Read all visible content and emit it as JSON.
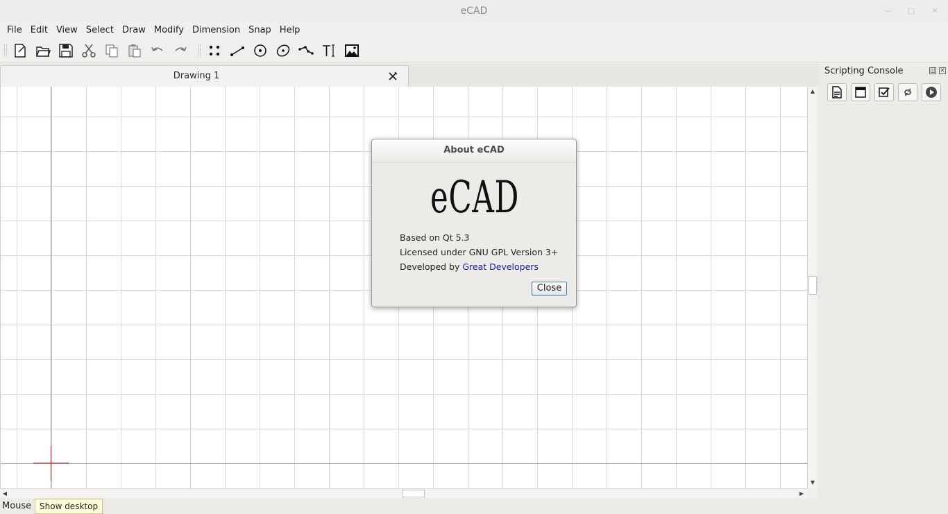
{
  "window": {
    "title": "eCAD"
  },
  "menu": [
    "File",
    "Edit",
    "View",
    "Select",
    "Draw",
    "Modify",
    "Dimension",
    "Snap",
    "Help"
  ],
  "toolbar": {
    "icons": [
      "new-file-icon",
      "open-folder-icon",
      "save-icon",
      "cut-icon",
      "copy-icon",
      "paste-icon",
      "undo-icon",
      "redo-icon",
      "point-icon",
      "line-icon",
      "circle-icon",
      "ellipse-icon",
      "polyline-icon",
      "text-icon",
      "image-icon"
    ]
  },
  "tab": {
    "label": "Drawing 1"
  },
  "dock": {
    "title": "Scripting Console",
    "buttons": [
      "new-script-icon",
      "window-icon",
      "checkbox-icon",
      "refresh-icon",
      "run-icon"
    ]
  },
  "status": {
    "text": "Mouse m",
    "tooltip": "Show desktop"
  },
  "dialog": {
    "title": "About eCAD",
    "logo": "eCAD",
    "line1": "Based on Qt 5.3",
    "line2": "Licensed under GNU GPL Version 3+",
    "line3_prefix": "Developed by ",
    "line3_link": "Great Developers",
    "close_label": "Close"
  },
  "colors": {
    "cursor": "#d21c1c",
    "link": "#1a1aa6",
    "grid": "#d8d8d8",
    "focus_border": "#3d6ea5"
  }
}
